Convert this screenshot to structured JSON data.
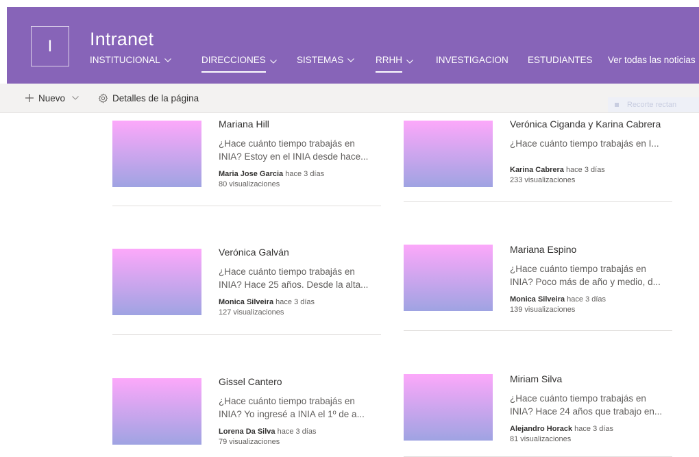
{
  "site": {
    "logo_letter": "I",
    "title": "Intranet"
  },
  "nav": [
    {
      "label": "INSTITUCIONAL",
      "dropdown": true
    },
    {
      "label": "DIRECCIONES",
      "dropdown": true,
      "active": true
    },
    {
      "label": "SISTEMAS",
      "dropdown": true
    },
    {
      "label": "RRHH",
      "dropdown": true,
      "active": true
    },
    {
      "label": "INVESTIGACION",
      "dropdown": false
    },
    {
      "label": "ESTUDIANTES",
      "dropdown": false
    },
    {
      "label": "Ver todas las noticias",
      "dropdown": false
    }
  ],
  "commandbar": {
    "new_label": "Nuevo",
    "details_label": "Detalles de la página",
    "faded_label": "Recorte rectan"
  },
  "cards": [
    {
      "title": "Mariana Hill",
      "desc": "¿Hace cuánto tiempo trabajás en INIA? Estoy en el INIA desde hace...",
      "author": "Maria Jose Garcia",
      "time": "hace 3 días",
      "views": "80 visualizaciones"
    },
    {
      "title": "Verónica Ciganda y Karina Cabrera",
      "desc": "¿Hace cuánto tiempo trabajás en I...",
      "author": "Karina Cabrera",
      "time": "hace 3 días",
      "views": "233 visualizaciones"
    },
    {
      "title": "Verónica Galván",
      "desc": "¿Hace cuánto tiempo trabajás en INIA? Hace 25 años. Desde la alta...",
      "author": "Monica Silveira",
      "time": "hace 3 días",
      "views": "127 visualizaciones"
    },
    {
      "title": "Mariana Espino",
      "desc": "¿Hace cuánto tiempo trabajás en INIA? Poco más de año y medio, d...",
      "author": "Monica Silveira",
      "time": "hace 3 días",
      "views": "139 visualizaciones"
    },
    {
      "title": "Gissel Cantero",
      "desc": "¿Hace cuánto tiempo trabajás en INIA? Yo ingresé a INIA el 1º de a...",
      "author": "Lorena Da Silva",
      "time": "hace 3 días",
      "views": "79 visualizaciones"
    },
    {
      "title": "Miriam Silva",
      "desc": "¿Hace cuánto tiempo trabajás en INIA? Hace 24 años que trabajo en...",
      "author": "Alejandro Horack",
      "time": "hace 3 días",
      "views": "81 visualizaciones"
    }
  ]
}
